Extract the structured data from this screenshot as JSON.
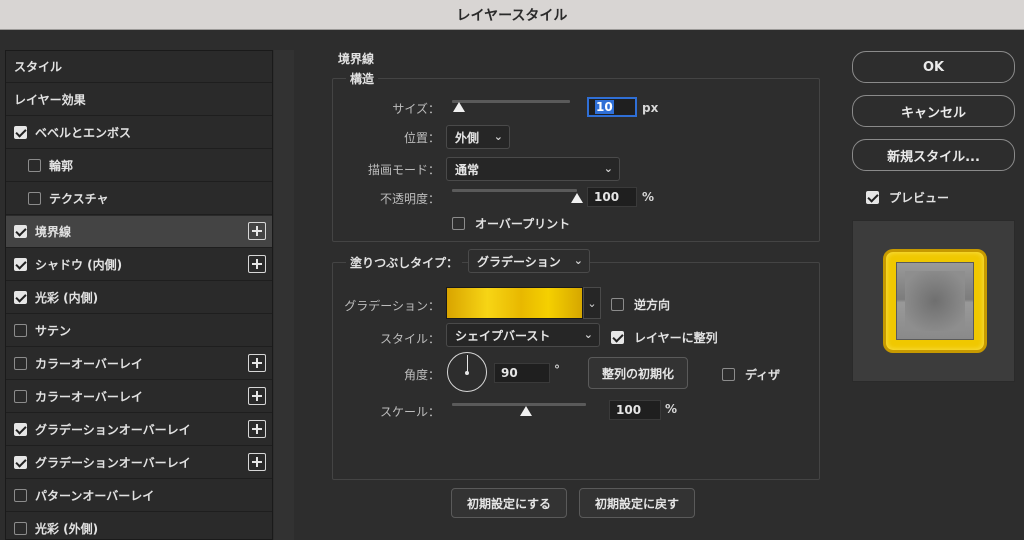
{
  "window": {
    "title": "レイヤースタイル"
  },
  "left_panel": {
    "items": [
      {
        "label": "スタイル",
        "checkbox": false,
        "checked": false,
        "plus": false,
        "selected": false,
        "indent": false
      },
      {
        "label": "レイヤー効果",
        "checkbox": false,
        "checked": false,
        "plus": false,
        "selected": false,
        "indent": false
      },
      {
        "label": "ベベルとエンボス",
        "checkbox": true,
        "checked": true,
        "plus": false,
        "selected": false,
        "indent": false
      },
      {
        "label": "輪郭",
        "checkbox": true,
        "checked": false,
        "plus": false,
        "selected": false,
        "indent": true
      },
      {
        "label": "テクスチャ",
        "checkbox": true,
        "checked": false,
        "plus": false,
        "selected": false,
        "indent": true
      },
      {
        "label": "境界線",
        "checkbox": true,
        "checked": true,
        "plus": true,
        "selected": true,
        "indent": false
      },
      {
        "label": "シャドウ (内側)",
        "checkbox": true,
        "checked": true,
        "plus": true,
        "selected": false,
        "indent": false
      },
      {
        "label": "光彩 (内側)",
        "checkbox": true,
        "checked": true,
        "plus": false,
        "selected": false,
        "indent": false
      },
      {
        "label": "サテン",
        "checkbox": true,
        "checked": false,
        "plus": false,
        "selected": false,
        "indent": false
      },
      {
        "label": "カラーオーバーレイ",
        "checkbox": true,
        "checked": false,
        "plus": true,
        "selected": false,
        "indent": false
      },
      {
        "label": "カラーオーバーレイ",
        "checkbox": true,
        "checked": false,
        "plus": true,
        "selected": false,
        "indent": false
      },
      {
        "label": "グラデーションオーバーレイ",
        "checkbox": true,
        "checked": true,
        "plus": true,
        "selected": false,
        "indent": false
      },
      {
        "label": "グラデーションオーバーレイ",
        "checkbox": true,
        "checked": true,
        "plus": true,
        "selected": false,
        "indent": false
      },
      {
        "label": "パターンオーバーレイ",
        "checkbox": true,
        "checked": false,
        "plus": false,
        "selected": false,
        "indent": false
      },
      {
        "label": "光彩 (外側)",
        "checkbox": true,
        "checked": false,
        "plus": false,
        "selected": false,
        "indent": false
      }
    ]
  },
  "stroke": {
    "section_title": "境界線",
    "structure_title": "構造",
    "size_label": "サイズ：",
    "size_value": "10",
    "size_unit": "px",
    "size_slider_fraction": 0.06,
    "position_label": "位置：",
    "position_value": "外側",
    "blend_label": "描画モード：",
    "blend_value": "通常",
    "opacity_label": "不透明度：",
    "opacity_value": "100",
    "opacity_unit": "%",
    "opacity_slider_fraction": 1.0,
    "overprint_label": "オーバープリント",
    "overprint_checked": false
  },
  "fill": {
    "fill_type_label": "塗りつぶしタイプ：",
    "fill_type_value": "グラデーション",
    "gradient_label": "グラデーション：",
    "reverse_label": "逆方向",
    "reverse_checked": false,
    "style_label": "スタイル：",
    "style_value": "シェイプバースト",
    "align_label": "レイヤーに整列",
    "align_checked": true,
    "angle_label": "角度：",
    "angle_value": "90",
    "angle_unit": "°",
    "reset_align_label": "整列の初期化",
    "dither_label": "ディザ",
    "dither_checked": false,
    "scale_label": "スケール：",
    "scale_value": "100",
    "scale_unit": "%",
    "scale_slider_fraction": 0.55
  },
  "bottom_buttons": {
    "make_default": "初期設定にする",
    "reset_default": "初期設定に戻す"
  },
  "right_panel": {
    "ok": "OK",
    "cancel": "キャンセル",
    "new_style": "新規スタイル...",
    "preview_label": "プレビュー",
    "preview_checked": true
  },
  "colors": {
    "gold": "#f0c800",
    "accent_blue": "#2f6fd6"
  }
}
